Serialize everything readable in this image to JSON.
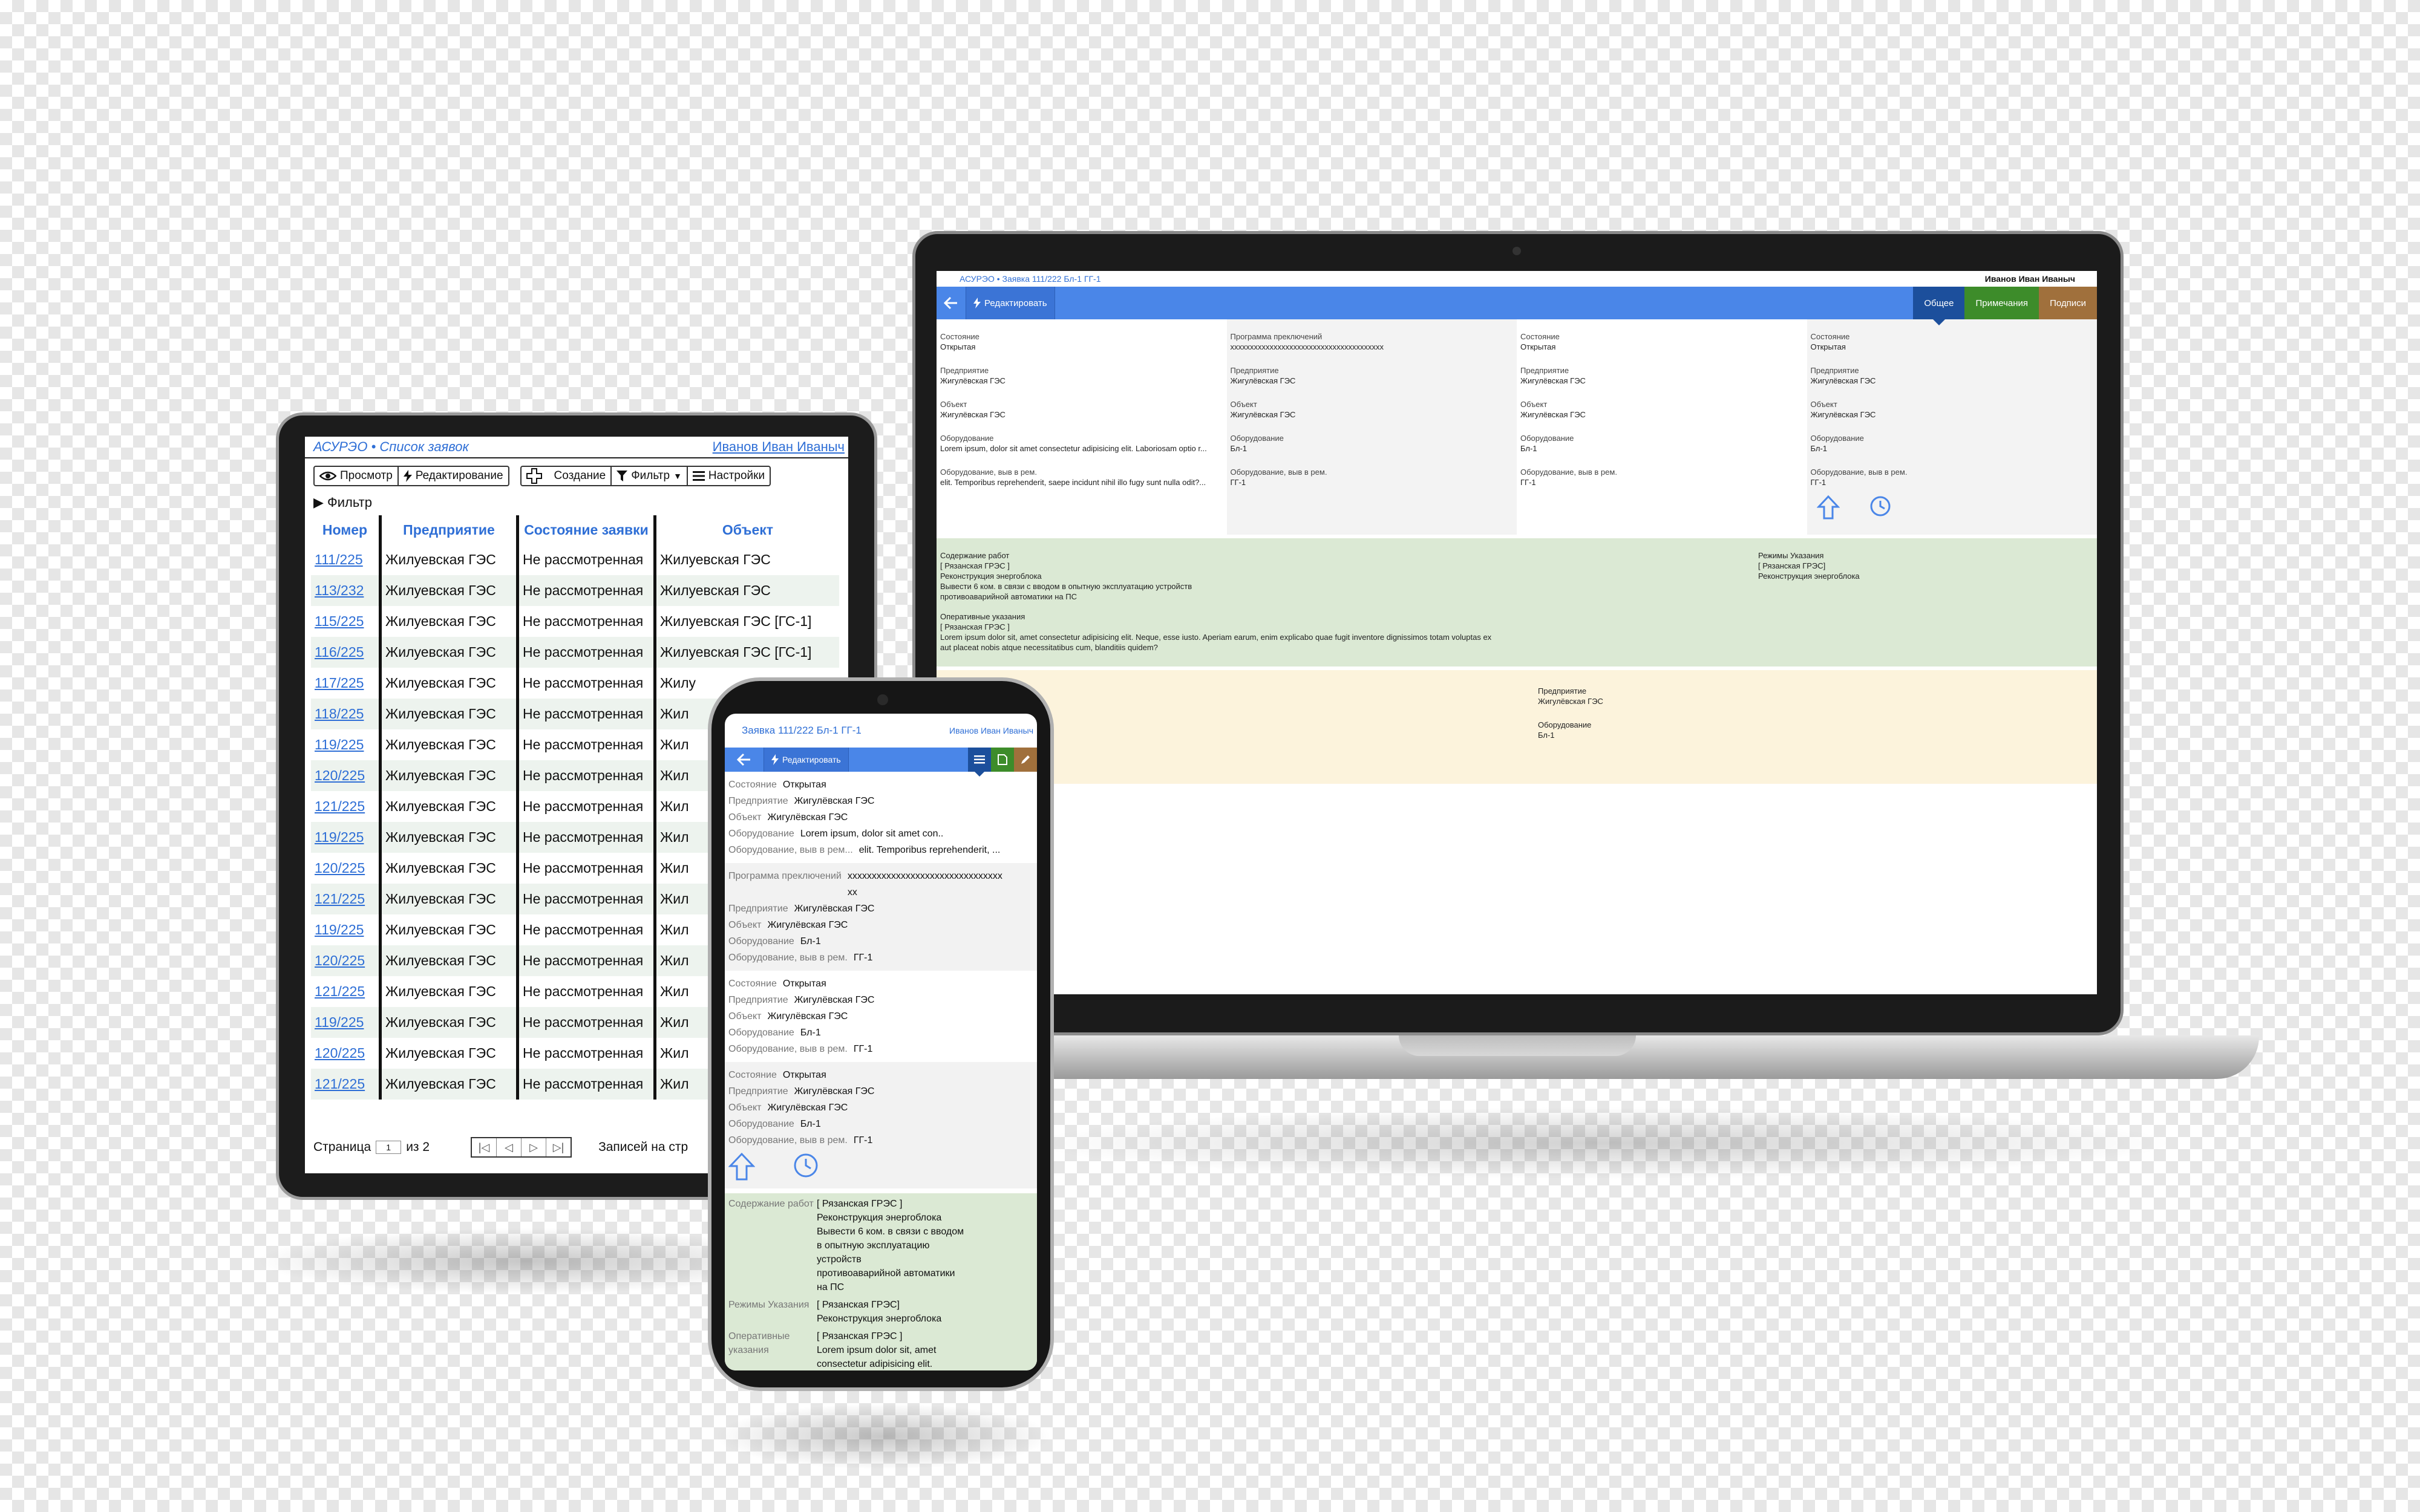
{
  "laptop": {
    "title": "АСУРЭО • Заявка 111/222 Бл-1 ГГ-1",
    "user": "Иванов Иван Иваныч",
    "edit_label": "Редактировать",
    "tabs": [
      "Общее",
      "Примечания",
      "Подписи"
    ],
    "columns": [
      {
        "fields": [
          {
            "label": "Состояние",
            "value": "Открытая"
          },
          {
            "label": "Предприятие",
            "value": "Жигулёвская ГЭС"
          },
          {
            "label": "Объект",
            "value": "Жигулёвская ГЭС"
          },
          {
            "label": "Оборудование",
            "value": "Lorem ipsum, dolor sit amet consectetur adipisicing elit. Laboriosam optio r..."
          },
          {
            "label": "Оборудование, выв в рем.",
            "value": "elit. Temporibus reprehenderit, saepe incidunt nihil illo fugy sunt nulla odit?..."
          }
        ]
      },
      {
        "fields": [
          {
            "label": "Программа преключений",
            "value": "xxxxxxxxxxxxxxxxxxxxxxxxxxxxxxxxxxxxxxx"
          },
          {
            "label": "Предприятие",
            "value": "Жигулёвская ГЭС"
          },
          {
            "label": "Объект",
            "value": "Жигулёвская ГЭС"
          },
          {
            "label": "Оборудование",
            "value": "Бл-1"
          },
          {
            "label": "Оборудование, выв в рем.",
            "value": "ГГ-1"
          }
        ]
      },
      {
        "fields": [
          {
            "label": "Состояние",
            "value": "Открытая"
          },
          {
            "label": "Предприятие",
            "value": "Жигулёвская ГЭС"
          },
          {
            "label": "Объект",
            "value": "Жигулёвская ГЭС"
          },
          {
            "label": "Оборудование",
            "value": "Бл-1"
          },
          {
            "label": "Оборудование, выв в рем.",
            "value": "ГГ-1"
          }
        ]
      },
      {
        "fields": [
          {
            "label": "Состояние",
            "value": "Открытая"
          },
          {
            "label": "Предприятие",
            "value": "Жигулёвская ГЭС"
          },
          {
            "label": "Объект",
            "value": "Жигулёвская ГЭС"
          },
          {
            "label": "Оборудование",
            "value": "Бл-1"
          },
          {
            "label": "Оборудование, выв в рем.",
            "value": "ГГ-1"
          }
        ]
      }
    ],
    "work": {
      "label": "Содержание работ",
      "lines": [
        "[ Рязанская ГРЭС ]",
        "Реконструкция энергоблока",
        "Вывести 6 ком. в связи с вводом в опытную эксплуатацию устройств",
        "противоаварийной автоматики на ПС"
      ]
    },
    "instructions": {
      "label": "Оперативные указания",
      "lines": [
        "[ Рязанская ГРЭС ]",
        "Lorem ipsum dolor sit, amet consectetur adipisicing elit. Neque, esse iusto. Aperiam earum, enim explicabo quae fugit inventore dignissimos totam voluptas ex",
        "aut placeat nobis atque necessitatibus cum, blanditiis quidem?"
      ]
    },
    "modes": {
      "label": "Режимы Указания",
      "lines": [
        "[ Рязанская ГРЭС]",
        "Реконструкция энергоблока"
      ]
    },
    "yellow": [
      {
        "label": "Предприятие",
        "value": "Жигулёвская ГЭС"
      },
      {
        "label": "Оборудование",
        "value": "Бл-1"
      }
    ]
  },
  "tablet": {
    "title": "АСУРЭО • Список заявок",
    "user": "Иванов Иван Иваныч",
    "toolbar": {
      "view": "Просмотр",
      "edit": "Редактирование",
      "create": "Создание",
      "filter": "Фильтр",
      "settings": "Настройки"
    },
    "filter_label": "▶ Фильтр",
    "columns": [
      "Номер",
      "Предприятие",
      "Состояние заявки",
      "Объект"
    ],
    "rows": [
      [
        "111/225",
        "Жилуевская ГЭС",
        "Не рассмотренная",
        "Жилуевская ГЭС"
      ],
      [
        "113/232",
        "Жилуевская ГЭС",
        "Не рассмотренная",
        "Жилуевская ГЭС"
      ],
      [
        "115/225",
        "Жилуевская ГЭС",
        "Не рассмотренная",
        "Жилуевская ГЭС [ГС-1]"
      ],
      [
        "116/225",
        "Жилуевская ГЭС",
        "Не рассмотренная",
        "Жилуевская ГЭС [ГС-1]"
      ],
      [
        "117/225",
        "Жилуевская ГЭС",
        "Не рассмотренная",
        "Жилу"
      ],
      [
        "118/225",
        "Жилуевская ГЭС",
        "Не рассмотренная",
        "Жил"
      ],
      [
        "119/225",
        "Жилуевская ГЭС",
        "Не рассмотренная",
        "Жил"
      ],
      [
        "120/225",
        "Жилуевская ГЭС",
        "Не рассмотренная",
        "Жил"
      ],
      [
        "121/225",
        "Жилуевская ГЭС",
        "Не рассмотренная",
        "Жил"
      ],
      [
        "119/225",
        "Жилуевская ГЭС",
        "Не рассмотренная",
        "Жил"
      ],
      [
        "120/225",
        "Жилуевская ГЭС",
        "Не рассмотренная",
        "Жил"
      ],
      [
        "121/225",
        "Жилуевская ГЭС",
        "Не рассмотренная",
        "Жил"
      ],
      [
        "119/225",
        "Жилуевская ГЭС",
        "Не рассмотренная",
        "Жил"
      ],
      [
        "120/225",
        "Жилуевская ГЭС",
        "Не рассмотренная",
        "Жил"
      ],
      [
        "121/225",
        "Жилуевская ГЭС",
        "Не рассмотренная",
        "Жил"
      ],
      [
        "119/225",
        "Жилуевская ГЭС",
        "Не рассмотренная",
        "Жил"
      ],
      [
        "120/225",
        "Жилуевская ГЭС",
        "Не рассмотренная",
        "Жил"
      ],
      [
        "121/225",
        "Жилуевская ГЭС",
        "Не рассмотренная",
        "Жил"
      ]
    ],
    "footer": {
      "page_label": "Страница",
      "page_value": "1",
      "of_label": "из 2",
      "records_label": "Записей на стр"
    }
  },
  "phone": {
    "title": "Заявка 111/222 Бл-1 ГГ-1",
    "user": "Иванов Иван Иваныч",
    "edit_label": "Редактировать",
    "sections": [
      {
        "rows": [
          {
            "label": "Состояние",
            "value": "Открытая"
          },
          {
            "label": "Предприятие",
            "value": "Жигулёвская ГЭС"
          },
          {
            "label": "Объект",
            "value": "Жигулёвская ГЭС"
          },
          {
            "label": "Оборудование",
            "value": "Lorem ipsum, dolor sit amet con.."
          },
          {
            "label": "Оборудование, выв в рем...",
            "value": "elit. Temporibus reprehenderit, ..."
          }
        ]
      },
      {
        "rows": [
          {
            "label": "Программа преключений",
            "value": "xxxxxxxxxxxxxxxxxxxxxxxxxxxxxxxxxx"
          },
          {
            "label": "Предприятие",
            "value": "Жигулёвская ГЭС"
          },
          {
            "label": "Объект",
            "value": "Жигулёвская ГЭС"
          },
          {
            "label": "Оборудование",
            "value": "Бл-1"
          },
          {
            "label": "Оборудование, выв в рем.",
            "value": "ГГ-1"
          }
        ]
      },
      {
        "rows": [
          {
            "label": "Состояние",
            "value": "Открытая"
          },
          {
            "label": "Предприятие",
            "value": "Жигулёвская ГЭС"
          },
          {
            "label": "Объект",
            "value": "Жигулёвская ГЭС"
          },
          {
            "label": "Оборудование",
            "value": "Бл-1"
          },
          {
            "label": "Оборудование, выв в рем.",
            "value": "ГГ-1"
          }
        ]
      },
      {
        "rows": [
          {
            "label": "Состояние",
            "value": "Открытая"
          },
          {
            "label": "Предприятие",
            "value": "Жигулёвская ГЭС"
          },
          {
            "label": "Объект",
            "value": "Жигулёвская ГЭС"
          },
          {
            "label": "Оборудование",
            "value": "Бл-1"
          },
          {
            "label": "Оборудование, выв в рем.",
            "value": "ГГ-1"
          }
        ]
      }
    ],
    "green": [
      {
        "label": "Содержание работ",
        "lines": [
          "[ Рязанская ГРЭС ]",
          "Реконструкция энергоблока",
          "Вывести 6 ком. в связи с вводом",
          "в опытную эксплуатацию",
          "устройств",
          "противоаварийной автоматики",
          "на ПС"
        ]
      },
      {
        "label": "Режимы Указания",
        "lines": [
          "[ Рязанская ГРЭС]",
          "Реконструкция энергоблока"
        ]
      },
      {
        "label": "Оперативные указания",
        "lines": [
          "[ Рязанская ГРЭС ]",
          "Lorem ipsum dolor sit, amet",
          "consectetur adipisicing elit."
        ]
      }
    ]
  },
  "colors": {
    "accent": "#4a86e8",
    "tab_active": "#1c4f9c",
    "tab_green": "#3d8c2a",
    "tab_brown": "#a0703c",
    "panel_green": "#dbe9d4",
    "panel_yellow": "#fcf3dc"
  },
  "icons": [
    "arrow-left-icon",
    "lightning-icon",
    "eye-icon",
    "plus-icon",
    "filter-icon",
    "menu-icon",
    "arrow-up-icon",
    "clock-icon",
    "document-icon",
    "pencil-icon"
  ]
}
